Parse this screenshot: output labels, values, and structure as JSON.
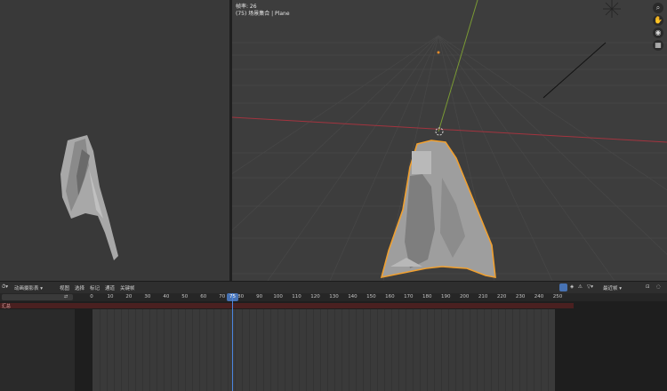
{
  "viewport": {
    "frame_rate_label": "帧率: 26",
    "object_info": "(75) 场景集合 | Plane"
  },
  "nav_gizmo": {
    "zoom_icon": "magnifier",
    "pan_icon": "hand",
    "camera_icon": "camera",
    "ortho_icon": "grid"
  },
  "timeline": {
    "editor_type_icon": "clock",
    "mode_label": "动画摄影表",
    "menu_view": "视图",
    "menu_select": "选择",
    "menu_marker": "标记",
    "menu_channel": "通道",
    "menu_key": "关键帧",
    "filter_label": "最近帧",
    "current_frame": "75",
    "ticks": [
      "0",
      "10",
      "20",
      "30",
      "40",
      "50",
      "60",
      "70",
      "80",
      "90",
      "100",
      "110",
      "120",
      "130",
      "140",
      "150",
      "160",
      "170",
      "180",
      "190",
      "200",
      "210",
      "220",
      "230",
      "240",
      "250"
    ],
    "summary_label": "汇总"
  },
  "colors": {
    "selection_outline": "#f0a030",
    "x_axis": "#a3343f",
    "y_axis": "#7a9a34",
    "playhead": "#4b86e0"
  }
}
